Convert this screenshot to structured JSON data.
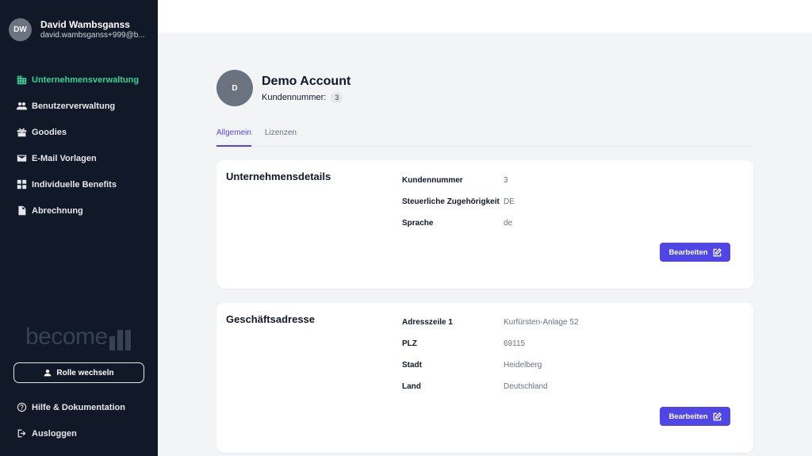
{
  "user": {
    "initials": "DW",
    "name": "David Wambsganss",
    "email": "david.wambsganss+999@b..."
  },
  "nav": [
    {
      "label": "Unternehmensverwaltung",
      "icon": "building-icon",
      "active": true
    },
    {
      "label": "Benutzerverwaltung",
      "icon": "users-icon"
    },
    {
      "label": "Goodies",
      "icon": "gift-icon"
    },
    {
      "label": "E-Mail Vorlagen",
      "icon": "mail-icon"
    },
    {
      "label": "Individuelle Benefits",
      "icon": "grid-icon"
    },
    {
      "label": "Abrechnung",
      "icon": "document-icon"
    }
  ],
  "brand": {
    "text": "become"
  },
  "role_button": {
    "label": "Rolle wechseln",
    "icon": "user-icon"
  },
  "bottom_nav": [
    {
      "label": "Hilfe & Dokumentation",
      "icon": "help-circle-icon"
    },
    {
      "label": "Ausloggen",
      "icon": "logout-icon"
    }
  ],
  "account": {
    "initial": "D",
    "title": "Demo Account",
    "customer_label": "Kundennummer:",
    "customer_number": "3"
  },
  "tabs": [
    "Allgemein",
    "Lizenzen"
  ],
  "company": {
    "title": "Unternehmensdetails",
    "rows": [
      {
        "key": "Kundennummer",
        "value": "3"
      },
      {
        "key": "Steuerliche Zugehörigkeit",
        "value": "DE"
      },
      {
        "key": "Sprache",
        "value": "de"
      }
    ],
    "edit_label": "Bearbeiten"
  },
  "address": {
    "title": "Geschäftsadresse",
    "rows": [
      {
        "key": "Adresszeile 1",
        "value": "Kurfürsten-Anlage 52"
      },
      {
        "key": "PLZ",
        "value": "69115"
      },
      {
        "key": "Stadt",
        "value": "Heidelberg"
      },
      {
        "key": "Land",
        "value": "Deutschland"
      }
    ],
    "edit_label": "Bearbeiten"
  },
  "colors": {
    "sidebar": "#111827",
    "active_nav": "#34d399",
    "primary": "#4f46e5"
  }
}
